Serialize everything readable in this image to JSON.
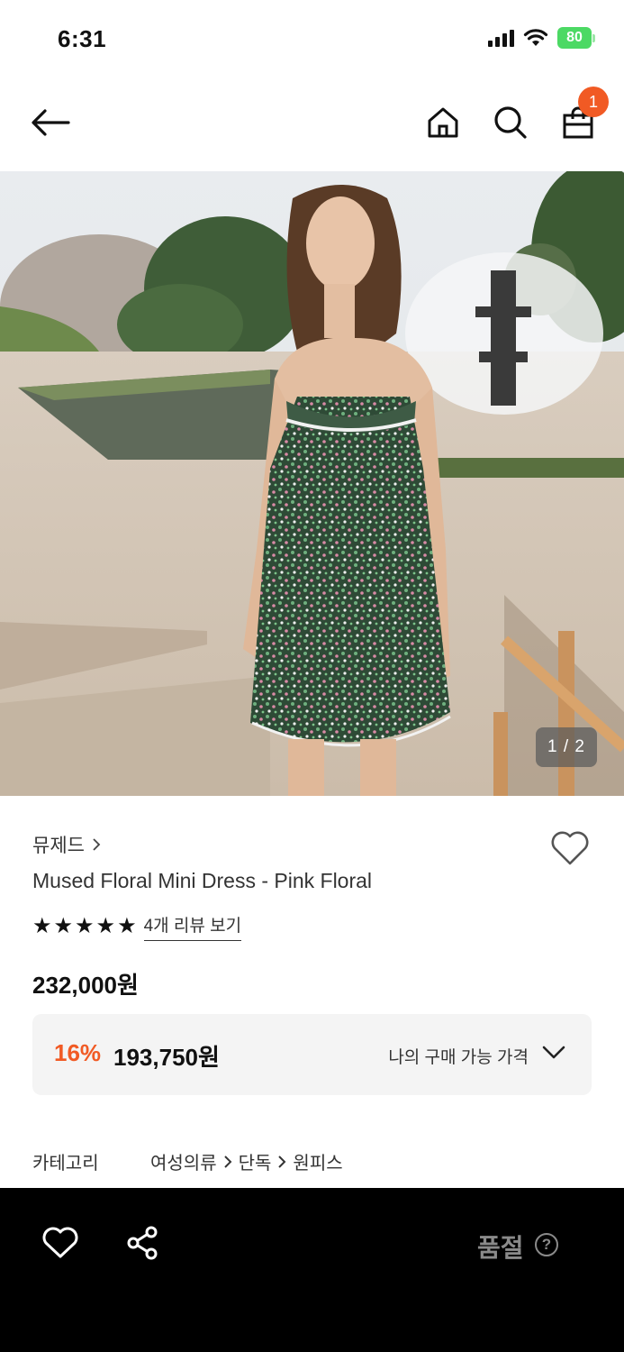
{
  "status_bar": {
    "time": "6:31",
    "battery": "80"
  },
  "header": {
    "cart_count": "1"
  },
  "gallery": {
    "counter": "1 / 2"
  },
  "product": {
    "brand": "뮤제드",
    "title": "Mused Floral Mini Dress - Pink Floral",
    "rating_stars": 5,
    "review_link": "4개 리뷰 보기",
    "original_price": "232,000원",
    "discount_rate": "16%",
    "discount_price": "193,750원",
    "price_dropdown_label": "나의 구매 가능 가격"
  },
  "category": {
    "label": "카테고리",
    "path": [
      "여성의류",
      "단독",
      "원피스"
    ]
  },
  "bottom_bar": {
    "status": "품절",
    "help_symbol": "?"
  },
  "colors": {
    "accent": "#f15a24",
    "battery": "#4cd964"
  }
}
